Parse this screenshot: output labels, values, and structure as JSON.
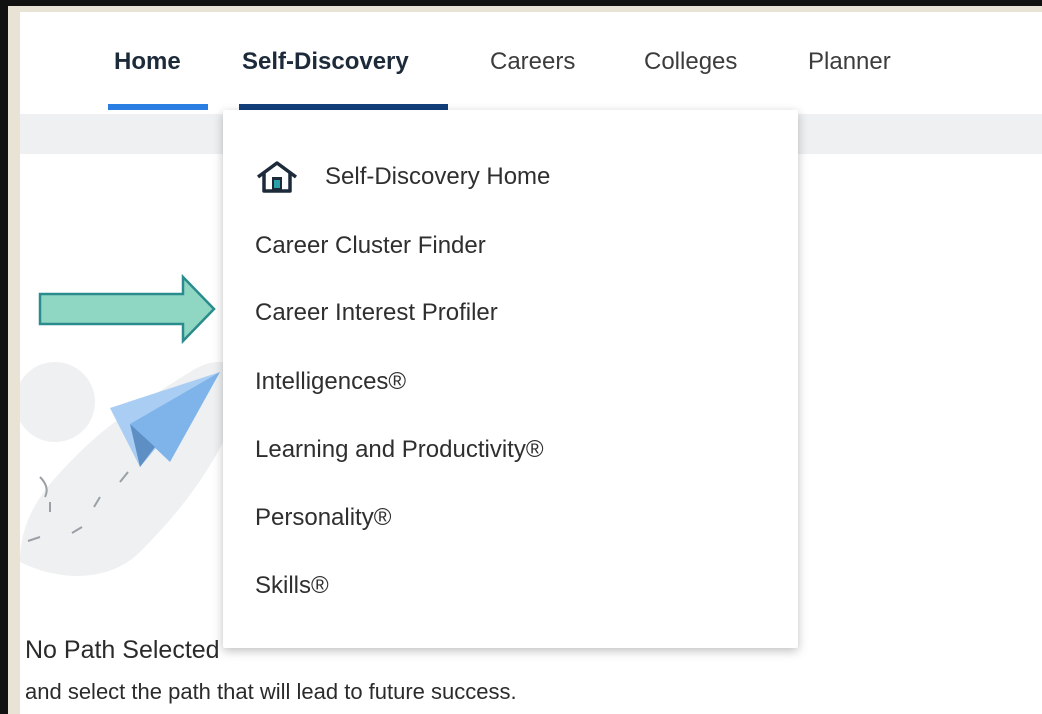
{
  "nav": {
    "tabs": [
      {
        "label": "Home"
      },
      {
        "label": "Self-Discovery"
      },
      {
        "label": "Careers"
      },
      {
        "label": "Colleges"
      },
      {
        "label": "Planner"
      }
    ],
    "home_underline_color": "#2a7de1",
    "active_underline_color": "#123e7a"
  },
  "dropdown": {
    "items": [
      {
        "label": "Self-Discovery Home",
        "icon": "home-icon"
      },
      {
        "label": "Career Cluster Finder"
      },
      {
        "label": "Career Interest Profiler"
      },
      {
        "label": "Intelligences®"
      },
      {
        "label": "Learning and Productivity®"
      },
      {
        "label": "Personality®"
      },
      {
        "label": "Skills®"
      }
    ]
  },
  "main": {
    "title": "No Path Selected",
    "subtitle": "and select the path that will lead to future success."
  },
  "annotation": {
    "icon": "pointer-arrow-icon",
    "color": "#8fd6c3"
  }
}
